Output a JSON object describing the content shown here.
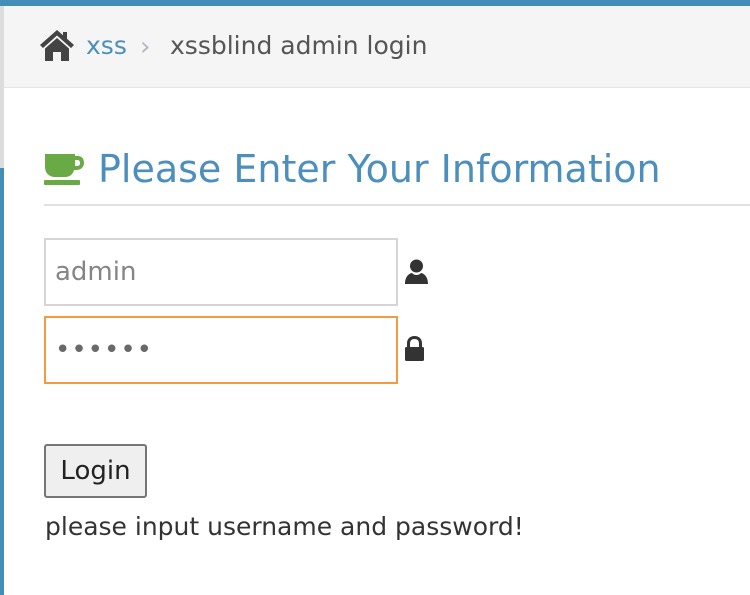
{
  "breadcrumb": {
    "home_icon": "home-icon",
    "link_label": "xss",
    "separator": "›",
    "current_label": "xssblind admin login"
  },
  "header": {
    "icon": "coffee-icon",
    "title": "Please Enter Your Information"
  },
  "form": {
    "username": {
      "value": "admin",
      "icon": "user-icon"
    },
    "password": {
      "value": "••••••",
      "icon": "lock-icon"
    },
    "login_label": "Login"
  },
  "message": "please input username and password!",
  "colors": {
    "accent_blue": "#438eb9",
    "link_blue": "#4c8fbd",
    "icon_green": "#69aa46",
    "focus_orange": "#f59942"
  }
}
